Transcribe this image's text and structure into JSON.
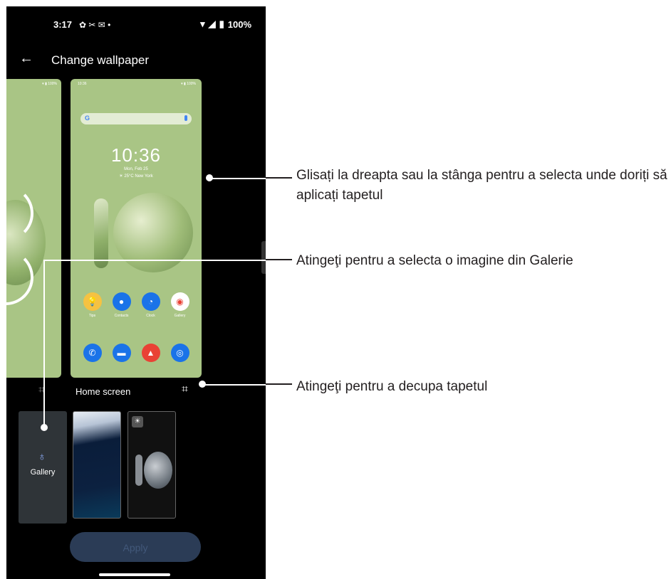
{
  "status_bar": {
    "time": "3:17",
    "battery": "100%"
  },
  "header": {
    "title": "Change wallpaper"
  },
  "preview": {
    "clock": "10:36",
    "date": "Mon, Feb 25",
    "weather": "25°C New York",
    "mini_battery": "100%",
    "mini_time": "10:36",
    "apps_row1": [
      "Tips",
      "Contacts",
      "Clock",
      "Gallery"
    ],
    "screen_label": "Home screen"
  },
  "gallery_tile": {
    "label": "Gallery"
  },
  "apply_button": "Apply",
  "callouts": {
    "swipe": "Glisați la dreapta sau la stânga pentru a selecta unde doriți să aplicați tapetul",
    "gallery": "Atingeţi pentru a selecta o imagine din Galerie",
    "crop": "Atingeţi pentru a decupa tapetul"
  },
  "colors": {
    "wallpaper_green": "#a9c585",
    "phone_bg": "#000000",
    "apply_bg": "#2b3c56"
  }
}
